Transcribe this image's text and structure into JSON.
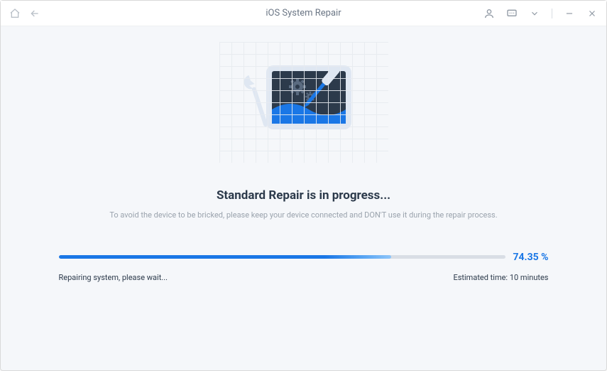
{
  "titlebar": {
    "title": "iOS System Repair"
  },
  "main": {
    "heading": "Standard Repair is in progress...",
    "subtext": "To avoid the device to be bricked, please keep your device connected and DON'T use it during the repair process."
  },
  "progress": {
    "percent_value": 74.35,
    "percent_label": "74.35 %",
    "fill_width": "74.35%",
    "status_left": "Repairing system, please wait...",
    "status_right": "Estimated time: 10 minutes"
  }
}
